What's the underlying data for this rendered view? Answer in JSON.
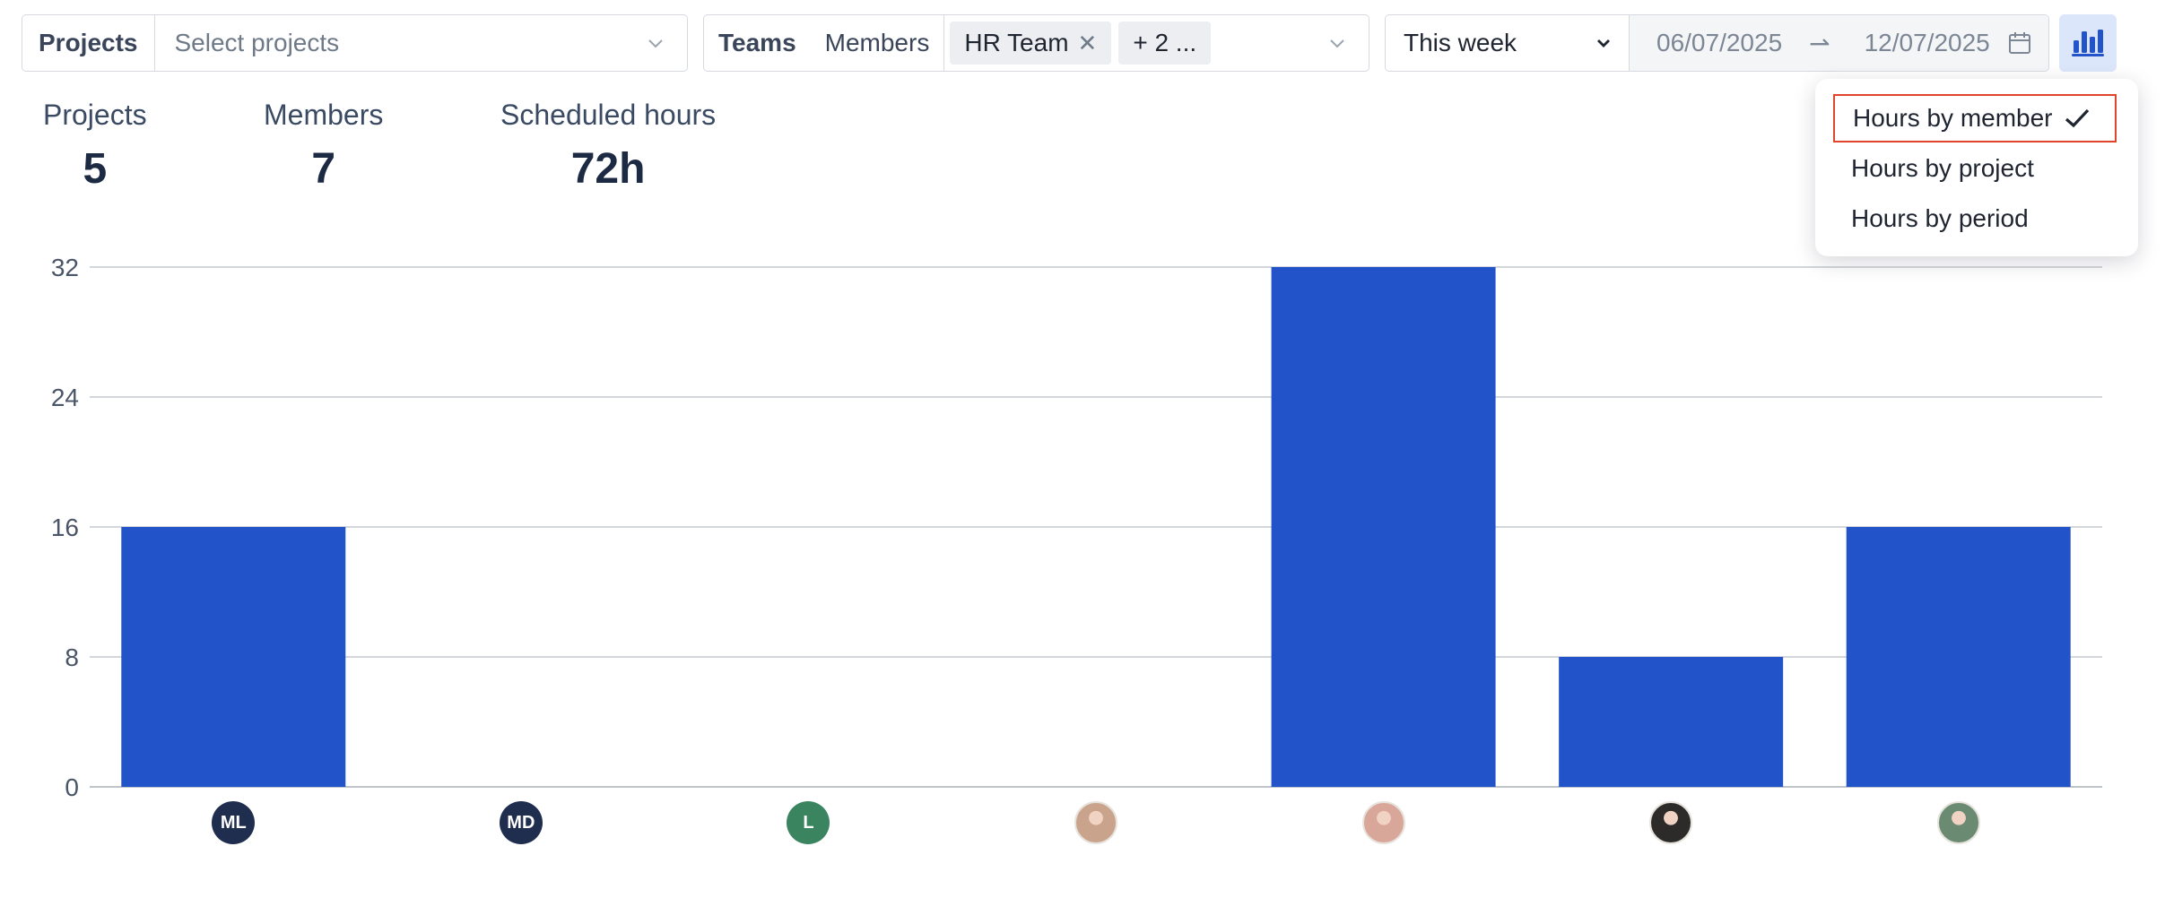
{
  "filters": {
    "projects": {
      "label": "Projects",
      "placeholder": "Select projects"
    },
    "teams": {
      "tab_teams": "Teams",
      "tab_members": "Members",
      "tags": [
        {
          "label": "HR Team",
          "removable": true
        },
        {
          "label": "+ 2 ...",
          "removable": false
        }
      ]
    },
    "period": {
      "selected": "This week",
      "start_date": "06/07/2025",
      "end_date": "12/07/2025"
    }
  },
  "stats": [
    {
      "label": "Projects",
      "value": "5"
    },
    {
      "label": "Members",
      "value": "7"
    },
    {
      "label": "Scheduled hours",
      "value": "72h"
    }
  ],
  "chart_view_menu": {
    "items": [
      {
        "label": "Hours by member",
        "selected": true
      },
      {
        "label": "Hours by project",
        "selected": false
      },
      {
        "label": "Hours by period",
        "selected": false
      }
    ]
  },
  "chart_data": {
    "type": "bar",
    "categories": [
      "ML",
      "MD",
      "L",
      "member-4",
      "member-5",
      "member-6",
      "member-7"
    ],
    "values": [
      16,
      0,
      0,
      0,
      32,
      8,
      16
    ],
    "ylim": [
      0,
      32
    ],
    "yticks": [
      0,
      8,
      16,
      24,
      32
    ],
    "grid": true,
    "bar_color": "#2353c8",
    "x_axis_avatars": [
      {
        "initials": "ML",
        "color": "#1f2d4e"
      },
      {
        "initials": "MD",
        "color": "#1f2d4e"
      },
      {
        "initials": "L",
        "color": "#3a8560"
      },
      {
        "initials": "",
        "color": "#c9a38c"
      },
      {
        "initials": "",
        "color": "#d9a79a"
      },
      {
        "initials": "",
        "color": "#2d2a2a"
      },
      {
        "initials": "",
        "color": "#6b8a72"
      }
    ]
  }
}
